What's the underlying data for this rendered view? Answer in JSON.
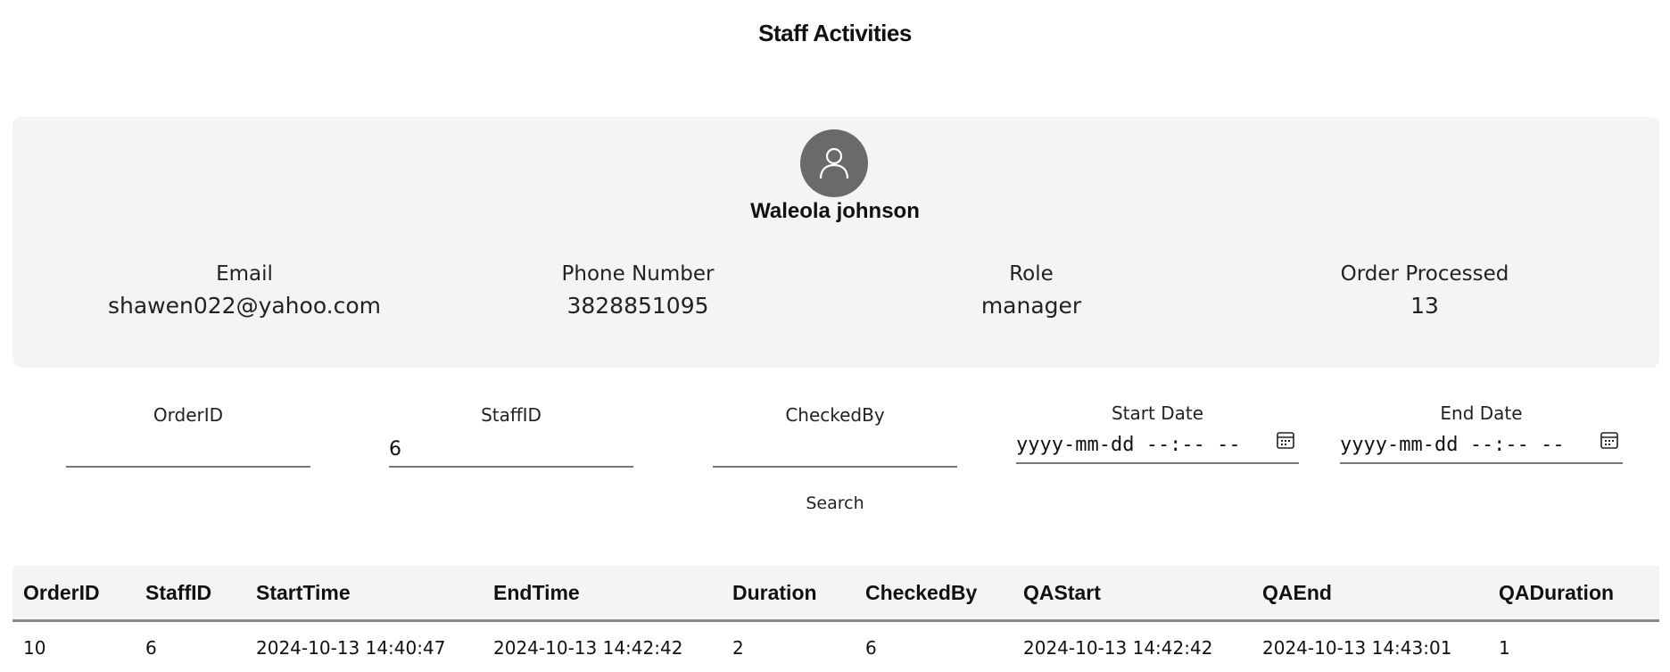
{
  "page": {
    "title": "Staff Activities"
  },
  "profile": {
    "avatar_icon": "user-icon",
    "name": "Waleola johnson",
    "fields": [
      {
        "label": "Email",
        "value": "shawen022@yahoo.com"
      },
      {
        "label": "Phone Number",
        "value": "3828851095"
      },
      {
        "label": "Role",
        "value": "manager"
      },
      {
        "label": "Order Processed",
        "value": "13"
      }
    ]
  },
  "filters": {
    "order_id": {
      "label": "OrderID",
      "value": ""
    },
    "staff_id": {
      "label": "StaffID",
      "value": "6"
    },
    "checked_by": {
      "label": "CheckedBy",
      "value": ""
    },
    "start_date": {
      "label": "Start Date",
      "placeholder": "yyyy-mm-dd --:-- --"
    },
    "end_date": {
      "label": "End Date",
      "placeholder": "yyyy-mm-dd --:-- --"
    },
    "calendar_icon": "calendar-icon",
    "search_label": "Search"
  },
  "table": {
    "columns": [
      "OrderID",
      "StaffID",
      "StartTime",
      "EndTime",
      "Duration",
      "CheckedBy",
      "QAStart",
      "QAEnd",
      "QADuration"
    ],
    "rows": [
      [
        "10",
        "6",
        "2024-10-13 14:40:47",
        "2024-10-13 14:42:42",
        "2",
        "6",
        "2024-10-13 14:42:42",
        "2024-10-13 14:43:01",
        "1"
      ]
    ]
  },
  "colors": {
    "card_background": "#f4f4f4",
    "avatar_background": "#6a6a6a",
    "underline": "#777777"
  }
}
